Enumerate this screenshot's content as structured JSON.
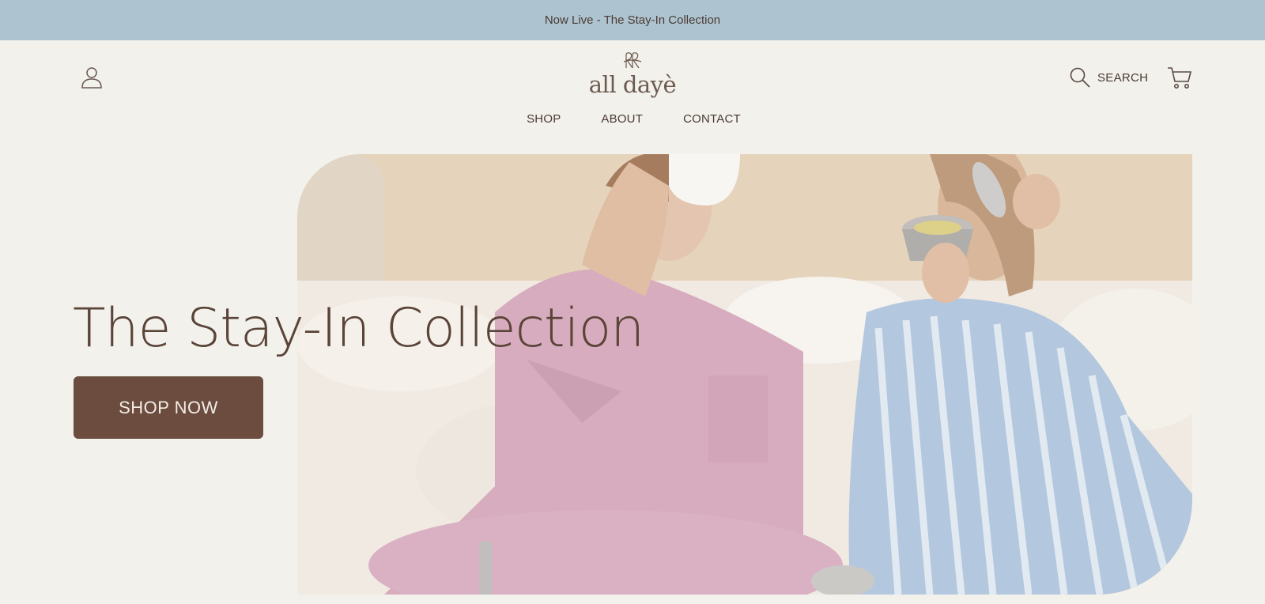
{
  "announcement": {
    "text": "Now Live - The Stay-In Collection"
  },
  "header": {
    "logo_text": "all dayè",
    "search_label": "SEARCH"
  },
  "nav": {
    "items": [
      {
        "label": "SHOP"
      },
      {
        "label": "ABOUT"
      },
      {
        "label": "CONTACT"
      }
    ]
  },
  "hero": {
    "title": "The Stay-In Collection",
    "cta_label": "SHOP NOW"
  },
  "colors": {
    "announcement_bg": "#adc4d0",
    "page_bg": "#f2f1ec",
    "brand_brown": "#6b4c3f",
    "text_dark": "#4a3a33"
  },
  "icons": [
    "account-icon",
    "search-icon",
    "cart-icon",
    "logo-monogram"
  ]
}
